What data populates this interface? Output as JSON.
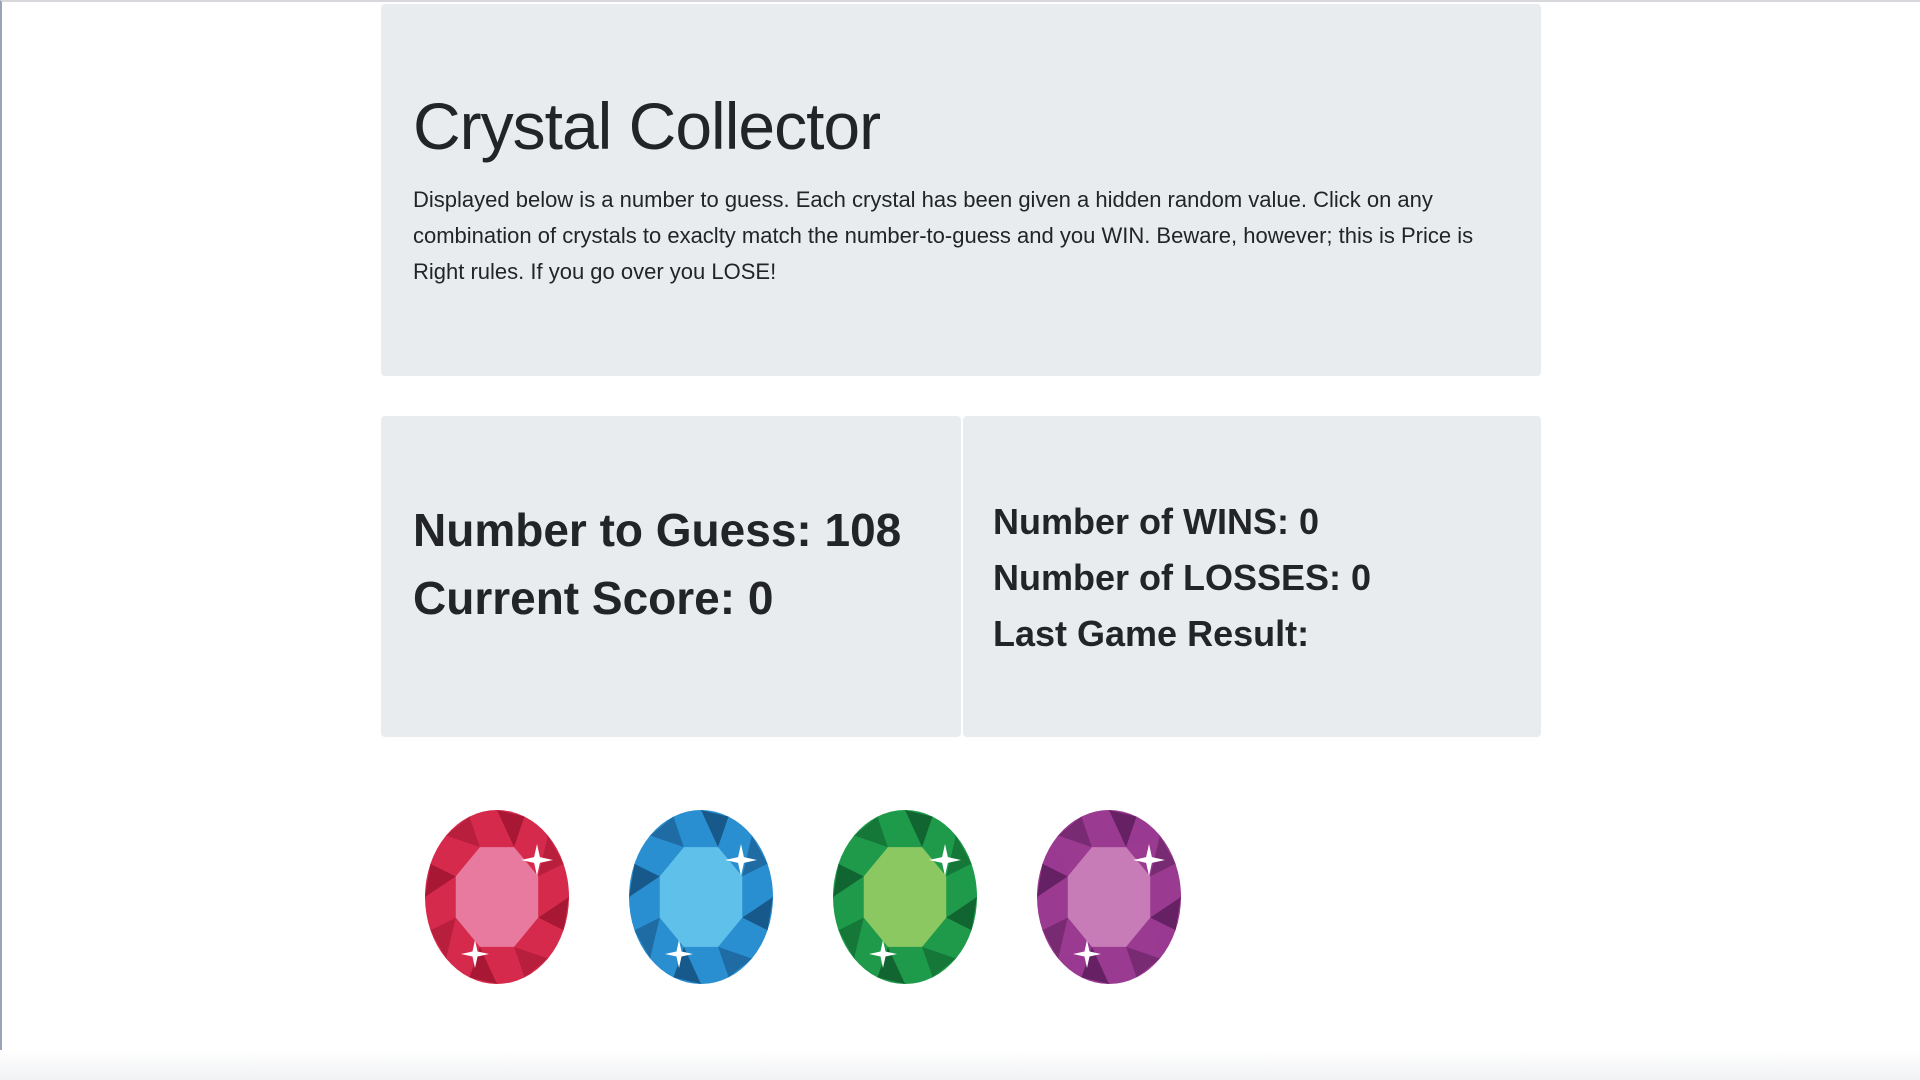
{
  "header": {
    "title": "Crystal Collector",
    "instructions": "Displayed below is a number to guess. Each crystal has been given a hidden random value. Click on any combination of crystals to exaclty match the number-to-guess and you WIN. Beware, however; this is Price is Right rules. If you go over you LOSE!"
  },
  "game": {
    "number_to_guess_text": "Number to Guess: 108",
    "current_score_text": "Current Score: 0",
    "number_to_guess": 108,
    "current_score": 0
  },
  "stats": {
    "wins_text": "Number of WINS: 0",
    "losses_text": "Number of LOSSES: 0",
    "last_result_text": "Last Game Result:",
    "wins": 0,
    "losses": 0
  },
  "crystals": [
    {
      "name": "red-crystal-icon",
      "color": "#d62a4c",
      "light": "#e8799f",
      "dark": "#a01530"
    },
    {
      "name": "blue-crystal-icon",
      "color": "#2a8fd1",
      "light": "#5fc1ea",
      "dark": "#15507f"
    },
    {
      "name": "green-crystal-icon",
      "color": "#1e9a4a",
      "light": "#8cc862",
      "dark": "#0f5c2b"
    },
    {
      "name": "purple-crystal-icon",
      "color": "#9a3a91",
      "light": "#c77bb7",
      "dark": "#5c1d5a"
    }
  ]
}
